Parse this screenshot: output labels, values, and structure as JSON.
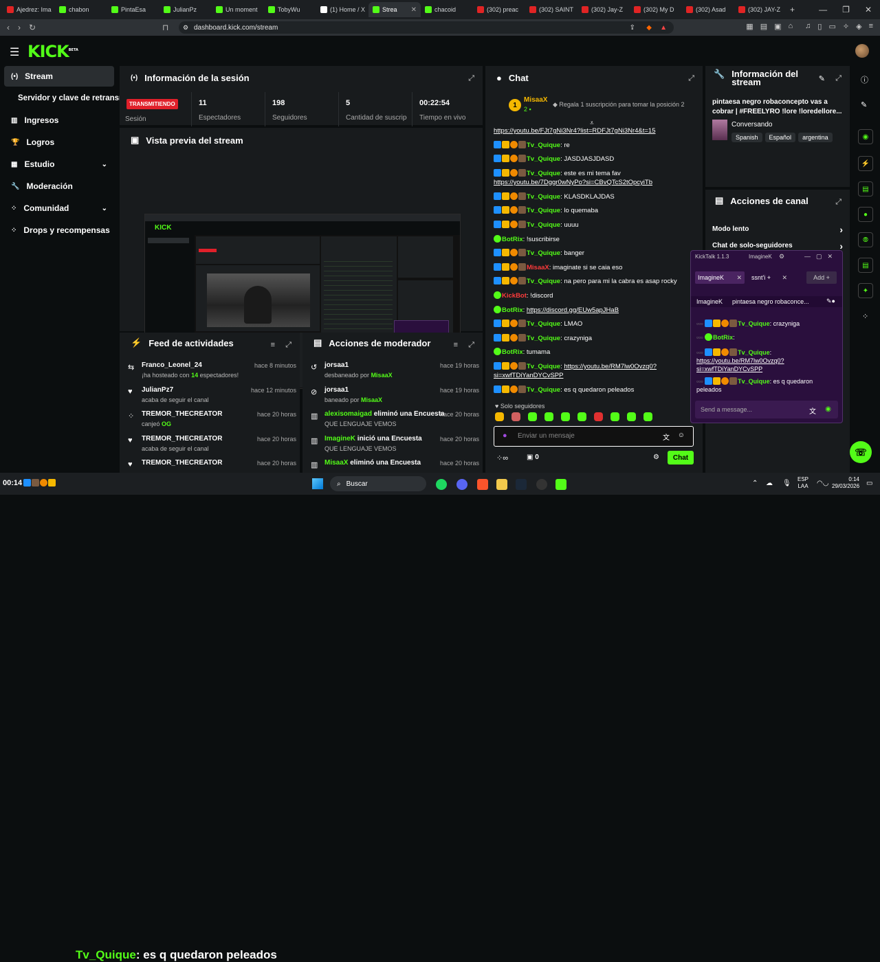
{
  "browser": {
    "tabs": [
      {
        "title": "Ajedrez: Ima",
        "fav": "r",
        "active": false
      },
      {
        "title": "chabon",
        "fav": "k",
        "active": false
      },
      {
        "title": "PintaEsa",
        "fav": "k",
        "active": false
      },
      {
        "title": "JulianPz",
        "fav": "k",
        "active": false
      },
      {
        "title": "Un moment",
        "fav": "k",
        "active": false
      },
      {
        "title": "TobyWu",
        "fav": "k",
        "active": false
      },
      {
        "title": "(1) Home / X",
        "fav": "x",
        "active": false
      },
      {
        "title": "Strea",
        "fav": "k",
        "active": true
      },
      {
        "title": "chacoid",
        "fav": "k",
        "active": false
      },
      {
        "title": "(302) preac",
        "fav": "r",
        "active": false
      },
      {
        "title": "(302) SAINT",
        "fav": "r",
        "active": false
      },
      {
        "title": "(302) Jay-Z",
        "fav": "r",
        "active": false
      },
      {
        "title": "(302) My D",
        "fav": "r",
        "active": false
      },
      {
        "title": "(302) Asad",
        "fav": "r",
        "active": false
      },
      {
        "title": "(302) JAY-Z",
        "fav": "r",
        "active": false
      }
    ],
    "url": "dashboard.kick.com/stream"
  },
  "nav": {
    "logo": "KICK",
    "logo_sup": "BETA"
  },
  "sidebar": {
    "items": [
      {
        "label": "Stream",
        "active": true,
        "icon": "broadcast-icon"
      },
      {
        "label": "Servidor y clave de retransm",
        "active": false,
        "icon": ""
      },
      {
        "label": "Ingresos",
        "active": false,
        "icon": "chart-icon"
      },
      {
        "label": "Logros",
        "active": false,
        "icon": "trophy-icon"
      },
      {
        "label": "Estudio",
        "active": false,
        "icon": "studio-icon",
        "chev": "⌄"
      },
      {
        "label": "Moderación",
        "active": false,
        "icon": "wrench-icon"
      },
      {
        "label": "Comunidad",
        "active": false,
        "icon": "community-icon",
        "chev": "⌄"
      },
      {
        "label": "Drops y recompensas",
        "active": false,
        "icon": "gift-icon"
      }
    ]
  },
  "session": {
    "title": "Información de la sesión",
    "badge": "TRANSMITIENDO",
    "session_label": "Sesión",
    "stats": [
      {
        "num": "11",
        "label": "Espectadores"
      },
      {
        "num": "198",
        "label": "Seguidores"
      },
      {
        "num": "5",
        "label": "Cantidad de suscripciones"
      },
      {
        "num": "00:22:54",
        "label": "Tiempo en vivo"
      }
    ]
  },
  "preview": {
    "title": "Vista previa del stream"
  },
  "feed": {
    "title": "Feed de actividades",
    "items": [
      {
        "name": "Franco_Leonel_24",
        "desc_pre": "¡ha hosteado con ",
        "desc_num": "14",
        "desc_post": " espectadores!",
        "time": "hace 8 minutos",
        "icon": "host-icon"
      },
      {
        "name": "JulianPz7",
        "desc_pre": "acaba de seguir el canal",
        "desc_num": "",
        "desc_post": "",
        "time": "hace 12 minutos",
        "icon": "heart-icon"
      },
      {
        "name": "TREMOR_THECREATOR",
        "desc_pre": "canjeó ",
        "desc_num": "OG",
        "desc_post": "",
        "time": "hace 20 horas",
        "icon": "points-icon"
      },
      {
        "name": "TREMOR_THECREATOR",
        "desc_pre": "acaba de seguir el canal",
        "desc_num": "",
        "desc_post": "",
        "time": "hace 20 horas",
        "icon": "heart-icon"
      },
      {
        "name": "TREMOR_THECREATOR",
        "desc_pre": "",
        "desc_num": "",
        "desc_post": "",
        "time": "hace 20 horas",
        "icon": "heart-icon"
      }
    ]
  },
  "modactions": {
    "title": "Acciones de moderador",
    "items": [
      {
        "name": "jorsaa1",
        "desc_pre": "desbaneado por ",
        "desc_user": "MisaaX",
        "time": "hace 19 horas",
        "icon": "unban-icon",
        "name_green": false
      },
      {
        "name": "jorsaa1",
        "desc_pre": "baneado por ",
        "desc_user": "MisaaX",
        "time": "hace 19 horas",
        "icon": "ban-icon",
        "name_green": false
      },
      {
        "name": "alexisomaigad",
        "action": " eliminó una Encuesta",
        "desc_pre": "QUE LENGUAJE VEMOS",
        "desc_user": "",
        "time": "hace 20 horas",
        "icon": "poll-icon",
        "name_green": true
      },
      {
        "name": "ImagineK",
        "action": " inició una Encuesta",
        "desc_pre": "QUE LENGUAJE VEMOS",
        "desc_user": "",
        "time": "hace 20 horas",
        "icon": "poll-icon",
        "name_green": true
      },
      {
        "name": "MisaaX",
        "action": " eliminó una Encuesta",
        "desc_pre": "",
        "desc_user": "",
        "time": "hace 20 horas",
        "icon": "poll-icon",
        "name_green": true
      }
    ]
  },
  "chat": {
    "title": "Chat",
    "top_user": "MisaaX",
    "top_count": "2",
    "top_rank": "1",
    "gift_text": "Regala 1 suscripción para tomar la posición 2",
    "messages": [
      {
        "user": "",
        "text": "https://youtu.be/FJt7gNi3Nr4?list=RDFJt7gNi3Nr4&t=15",
        "link": true
      },
      {
        "user": "Tv_Quique",
        "text": "re"
      },
      {
        "user": "Tv_Quique",
        "text": "JASDJASJDASD"
      },
      {
        "user": "Tv_Quique",
        "text": "este es mi tema fav",
        "text2": "https://youtu.be/7Dggr0wNyPo?si=CBvQTcS2tOpcyiTb"
      },
      {
        "user": "Tv_Quique",
        "text": "KLASDKLAJDAS"
      },
      {
        "user": "Tv_Quique",
        "text": "lo quemaba"
      },
      {
        "user": "Tv_Quique",
        "text": "uuuu"
      },
      {
        "user": "BotRix",
        "text": "!suscribirse",
        "bot": true
      },
      {
        "user": "Tv_Quique",
        "text": "banger"
      },
      {
        "user": "MisaaX",
        "text": "imaginate si se caia eso",
        "red": true
      },
      {
        "user": "Tv_Quique",
        "text": "na pero para mi la cabra es asap rocky"
      },
      {
        "user": "KickBot",
        "text": "!discord",
        "red": true,
        "bot": true
      },
      {
        "user": "BotRix",
        "text": "https://discord.gg/EUw5apJHaB",
        "bot": true,
        "link": true
      },
      {
        "user": "Tv_Quique",
        "text": "LMAO"
      },
      {
        "user": "Tv_Quique",
        "text": "crazyniga"
      },
      {
        "user": "BotRix",
        "text": "tumama",
        "bot": true
      },
      {
        "user": "Tv_Quique",
        "text": "https://youtu.be/RM7lw0Ovzq0?si=xwfTDiYanDYCvSPP",
        "link": true
      },
      {
        "user": "Tv_Quique",
        "text": "es q quedaron peleados"
      }
    ],
    "followers_only": "Solo seguidores",
    "input_placeholder": "Enviar un mensaje",
    "points": "0",
    "send_label": "Chat"
  },
  "stream_info": {
    "title": "Información del stream",
    "desc": "pintaesa negro robaconcepto vas a cobrar | #FREELYRO !lore !loredellore...",
    "category": "Conversando",
    "tags": [
      "Spanish",
      "Español",
      "argentina"
    ]
  },
  "channel_actions": {
    "title": "Acciones de canal",
    "items": [
      "Modo lento",
      "Chat de solo-seguidores"
    ]
  },
  "kicktalk": {
    "title": "KickTalk 1.1.3",
    "account": "ImagineK",
    "tabs": [
      "ImagineK",
      "ssnt'i +"
    ],
    "add_label": "Add +",
    "header_user": "ImagineK",
    "header_text": "pintaesa negro robaconce...",
    "messages": [
      {
        "user": "Tv_Quique",
        "text": "crazyniga"
      },
      {
        "user": "BotRix",
        "text": ""
      },
      {
        "user": "Tv_Quique",
        "text": "",
        "text2": "https://youtu.be/RM7lw0Ovzq0?si=xwfTDiYanDYCvSPP"
      },
      {
        "user": "Tv_Quique",
        "text": "es q quedaron peleados"
      }
    ],
    "input_placeholder": "Send a message..."
  },
  "taskbar": {
    "clock_left": "00:14",
    "overlay_user": "Tv_Quique",
    "overlay_text": ": es q quedaron peleados",
    "search": "Buscar",
    "lang": "ESP",
    "lang2": "LAA",
    "time": "0:14",
    "date": "29/03/2026"
  },
  "colors": {
    "accent": "#53fc18",
    "live": "#e0202a"
  }
}
